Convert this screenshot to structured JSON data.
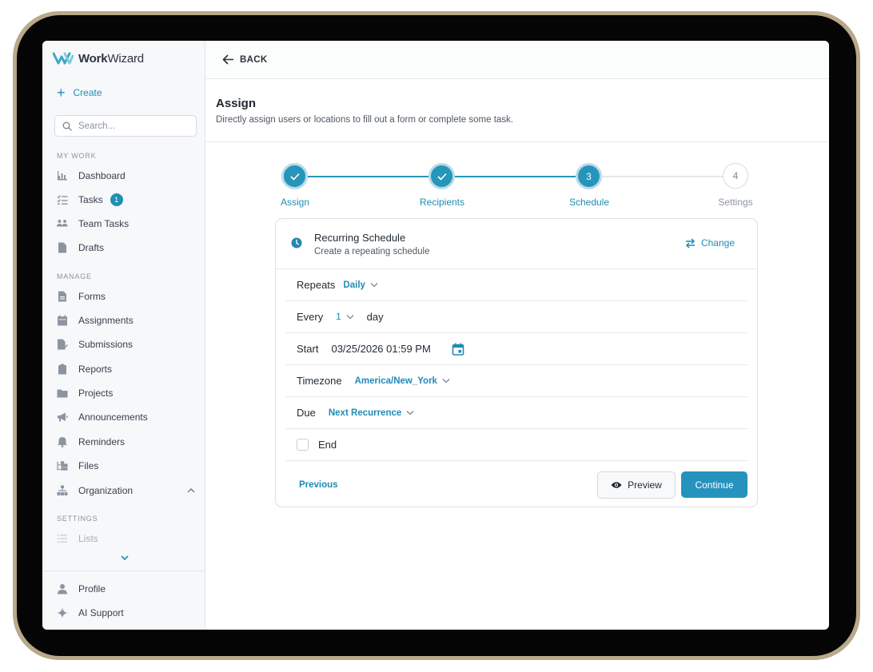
{
  "app": {
    "brand_bold": "Work",
    "brand_light": "Wizard"
  },
  "sidebar": {
    "create_label": "Create",
    "search_placeholder": "Search...",
    "sections": {
      "my_work": "MY WORK",
      "manage": "MANAGE",
      "settings": "SETTINGS"
    },
    "my_work_items": [
      {
        "label": "Dashboard",
        "icon": "chart-icon"
      },
      {
        "label": "Tasks",
        "icon": "checklist-icon",
        "badge": "1"
      },
      {
        "label": "Team Tasks",
        "icon": "team-icon"
      },
      {
        "label": "Drafts",
        "icon": "document-icon"
      }
    ],
    "manage_items": [
      {
        "label": "Forms",
        "icon": "form-icon"
      },
      {
        "label": "Assignments",
        "icon": "calendar-icon"
      },
      {
        "label": "Submissions",
        "icon": "submission-icon"
      },
      {
        "label": "Reports",
        "icon": "clipboard-icon"
      },
      {
        "label": "Projects",
        "icon": "folder-icon"
      },
      {
        "label": "Announcements",
        "icon": "megaphone-icon"
      },
      {
        "label": "Reminders",
        "icon": "bell-icon"
      },
      {
        "label": "Files",
        "icon": "files-icon"
      },
      {
        "label": "Organization",
        "icon": "org-icon"
      }
    ],
    "settings_items": [
      {
        "label": "Lists",
        "icon": "list-icon"
      }
    ],
    "footer_items": [
      {
        "label": "Profile",
        "icon": "user-icon"
      },
      {
        "label": "AI Support",
        "icon": "sparkle-icon"
      }
    ]
  },
  "topbar": {
    "back_label": "BACK"
  },
  "header": {
    "title": "Assign",
    "subtitle": "Directly assign users or locations to fill out a form or complete some task."
  },
  "stepper": {
    "steps": [
      {
        "label": "Assign",
        "state": "done"
      },
      {
        "label": "Recipients",
        "state": "done"
      },
      {
        "label": "Schedule",
        "state": "active",
        "number": "3"
      },
      {
        "label": "Settings",
        "state": "todo",
        "number": "4"
      }
    ]
  },
  "schedule": {
    "title": "Recurring Schedule",
    "subtitle": "Create a repeating schedule",
    "change_label": "Change",
    "repeats_label": "Repeats",
    "repeats_value": "Daily",
    "every_label": "Every",
    "every_value": "1",
    "every_unit": "day",
    "start_label": "Start",
    "start_value": "03/25/2026 01:59 PM",
    "timezone_label": "Timezone",
    "timezone_value": "America/New_York",
    "due_label": "Due",
    "due_value": "Next Recurrence",
    "end_label": "End",
    "end_checked": false
  },
  "footer": {
    "previous_label": "Previous",
    "preview_label": "Preview",
    "continue_label": "Continue"
  },
  "colors": {
    "accent": "#2593bd",
    "accent_light": "#b8dbe8",
    "sidebar_bg": "#f6f8fa",
    "device_bezel": "#b9a88a"
  }
}
